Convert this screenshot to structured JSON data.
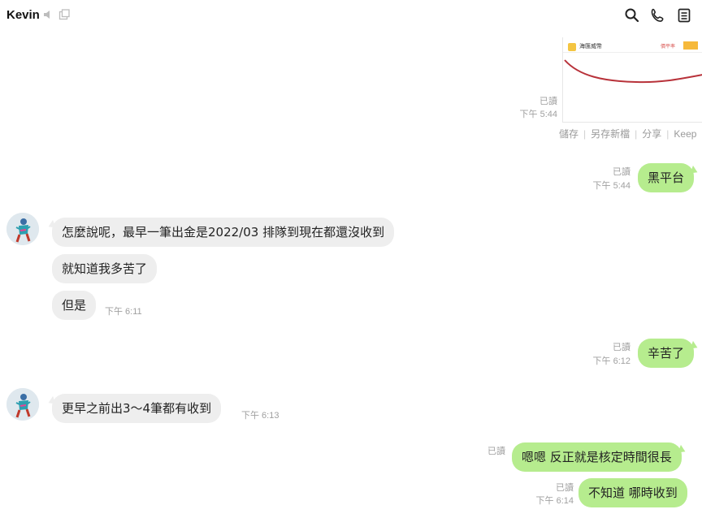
{
  "header": {
    "contact_name": "Kevin"
  },
  "image_message": {
    "app_title": "海匯威幣",
    "tag_a": "價平率",
    "read_label": "已讀",
    "time": "下午 5:44",
    "actions": [
      "儲存",
      "另存新檔",
      "分享",
      "Keep"
    ]
  },
  "messages": [
    {
      "id": "m1",
      "side": "out",
      "text": "黑平台",
      "read": "已讀",
      "time": "下午 5:44"
    },
    {
      "id": "m2",
      "side": "in",
      "text": "怎麼說呢，最早一筆出金是2022/03 排隊到現在都還沒收到",
      "time": ""
    },
    {
      "id": "m3",
      "side": "in",
      "text": "就知道我多苦了",
      "time": ""
    },
    {
      "id": "m4",
      "side": "in",
      "text": "但是",
      "time": "下午 6:11"
    },
    {
      "id": "m5",
      "side": "out",
      "text": "辛苦了",
      "read": "已讀",
      "time": "下午 6:12"
    },
    {
      "id": "m6",
      "side": "in",
      "text": "更早之前出3～4筆都有收到",
      "time": "下午 6:13"
    },
    {
      "id": "m7",
      "side": "out",
      "text": "嗯嗯 反正就是核定時間很長",
      "read": "已讀",
      "time": ""
    },
    {
      "id": "m8",
      "side": "out",
      "text": "不知道 哪時收到",
      "read": "已讀",
      "time": "下午 6:14"
    }
  ],
  "colors": {
    "outgoing_bubble": "#b6ec8e",
    "incoming_bubble": "#eeeeee",
    "meta_text": "#a0a0a0",
    "chart_line": "#b8323a"
  },
  "icons": [
    "mute-icon",
    "popout-icon",
    "search-icon",
    "phone-icon",
    "notes-icon",
    "avatar"
  ]
}
